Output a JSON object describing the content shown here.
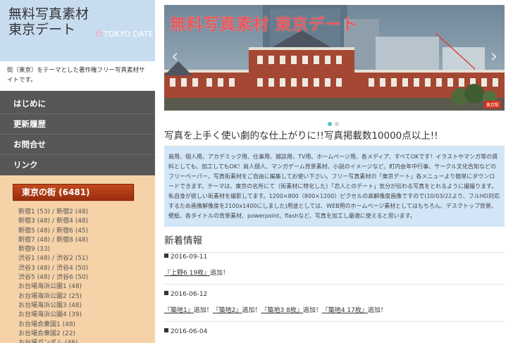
{
  "site": {
    "title_line1": "無料写真素材",
    "title_line2": "東京デート",
    "tagline_en": "TOKYO DATE",
    "description": "街（東京）をテーマとした著作権フリー写真素材サイトです。"
  },
  "nav": {
    "items": [
      "はじめに",
      "更新履歴",
      "お問合せ",
      "リンク"
    ]
  },
  "categories": {
    "header": "東京の街 (6481)",
    "rows": [
      [
        {
          "label": "新宿1 (53)"
        },
        {
          "label": "新宿2 (48)"
        }
      ],
      [
        {
          "label": "新宿3 (48)"
        },
        {
          "label": "新宿4 (48)"
        }
      ],
      [
        {
          "label": "新宿5 (48)"
        },
        {
          "label": "新宿6 (45)"
        }
      ],
      [
        {
          "label": "新宿7 (48)"
        },
        {
          "label": "新宿8 (48)"
        }
      ],
      [
        {
          "label": "新宿9 (33)"
        }
      ],
      [
        {
          "label": "渋谷1 (48)"
        },
        {
          "label": "渋谷2 (51)"
        }
      ],
      [
        {
          "label": "渋谷3 (48)"
        },
        {
          "label": "渋谷4 (50)"
        }
      ],
      [
        {
          "label": "渋谷5 (48)"
        },
        {
          "label": "渋谷6 (50)"
        }
      ],
      [
        {
          "label": "お台場海浜公園1 (48)"
        }
      ],
      [
        {
          "label": "お台場海浜公園2 (25)"
        }
      ],
      [
        {
          "label": "お台場海浜公園3 (48)"
        }
      ],
      [
        {
          "label": "お台場海浜公園4 (39)"
        }
      ],
      [
        {
          "label": "お台場合衆国1 (48)"
        }
      ],
      [
        {
          "label": "お台場合衆国2 (22)"
        }
      ],
      [
        {
          "label": "お台場ガンダム (46)"
        }
      ]
    ],
    "separator": "/"
  },
  "hero": {
    "title": "無料写真素材 東京デート",
    "badge": "東京駅",
    "prev": "‹",
    "next": "›"
  },
  "headline": "写真を上手く使い劇的な仕上がりに!!写真掲載数10000点以上!!",
  "intro": "商用、個人用、アカデミック用、仕事用、雑誌用、TV用、ホームページ用、各メディア、すべてOKです！イラストやマンガ等の資料としても、加工してもOK！商人個人、マンガゲーム背景素材、小説のイメージなど、町内会年中行事、サークル文化告知などのフリーペーパー、写真街素材をご自由に編集してお使い下さい。フリー写真素材の「東京デート」各メニューより簡単にダウンロードできます。テーマは、東京の名所にて（街素材に特化した）「恋人とのデート」気分が伝わる写真をとれるように撮撮ります。私自身が欲しい街素材を撮影してます。1200×800（800×1200）ピクセルの高解像度画像ですので(10/03/22より、フルHD対応するため画像解像度を2100x1400にしました)用途としては、WEB用のホームページ素材としてはもちろん、デスクトップ背景、壁紙、各タイトルの背景素材、powerpoint、flashなど、写真を加工し最適に使えると思います。",
  "news": {
    "heading": "新着情報",
    "entries": [
      {
        "date": "2016-09-11",
        "items": [
          {
            "link": "『上野6 19枚』",
            "suffix": "追加！"
          }
        ]
      },
      {
        "date": "2016-06-12",
        "items": [
          {
            "link": "『築地1』",
            "suffix": "追加！"
          },
          {
            "link": "『築地2』",
            "suffix": "追加！"
          },
          {
            "link": "『築地3 8枚』",
            "suffix": "追加！"
          },
          {
            "link": "『築地4 17枚』",
            "suffix": "追加！"
          }
        ]
      },
      {
        "date": "2016-06-04",
        "items": []
      }
    ]
  },
  "colors": {
    "header_bg": "#c8dcf0",
    "sidebar_bg": "#f6d2a8",
    "nav_bg": "#575757",
    "category_header": "#a8360f",
    "hero_title": "#e8585d",
    "intro_bg": "#d2e6f8",
    "dot_active": "#4dc7c4"
  }
}
